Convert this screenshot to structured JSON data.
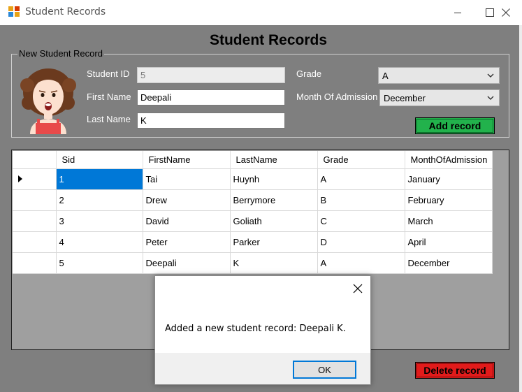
{
  "window": {
    "title": "Student Records",
    "icon": "app-icon",
    "controls": [
      "minimize-icon",
      "maximize-icon",
      "close-icon"
    ]
  },
  "form": {
    "heading": "Student Records",
    "group_label": "New Student Record",
    "labels": {
      "student_id": "Student ID",
      "first_name": "First Name",
      "last_name": "Last Name",
      "grade": "Grade",
      "month": "Month Of Admission"
    },
    "values": {
      "student_id": "5",
      "first_name": "Deepali",
      "last_name": "K",
      "grade": "A",
      "month": "December"
    },
    "add_button": "Add record",
    "delete_button": "Delete record"
  },
  "grid": {
    "columns": [
      "Sid",
      "FirstName",
      "LastName",
      "Grade",
      "MonthOfAdmission"
    ],
    "rows": [
      [
        "1",
        "Tai",
        "Huynh",
        "A",
        "January"
      ],
      [
        "2",
        "Drew",
        "Berrymore",
        "B",
        "February"
      ],
      [
        "3",
        "David",
        "Goliath",
        "C",
        "March"
      ],
      [
        "4",
        "Peter",
        "Parker",
        "D",
        "April"
      ],
      [
        "5",
        "Deepali",
        "K",
        "A",
        "December"
      ]
    ]
  },
  "dialog": {
    "message": "Added a new student record: Deepali K.",
    "ok_label": "OK"
  },
  "colors": {
    "add_button": "#22b24c",
    "delete_button": "#e21b1b",
    "selection": "#0078d7",
    "form_background": "#7f7f7f"
  }
}
